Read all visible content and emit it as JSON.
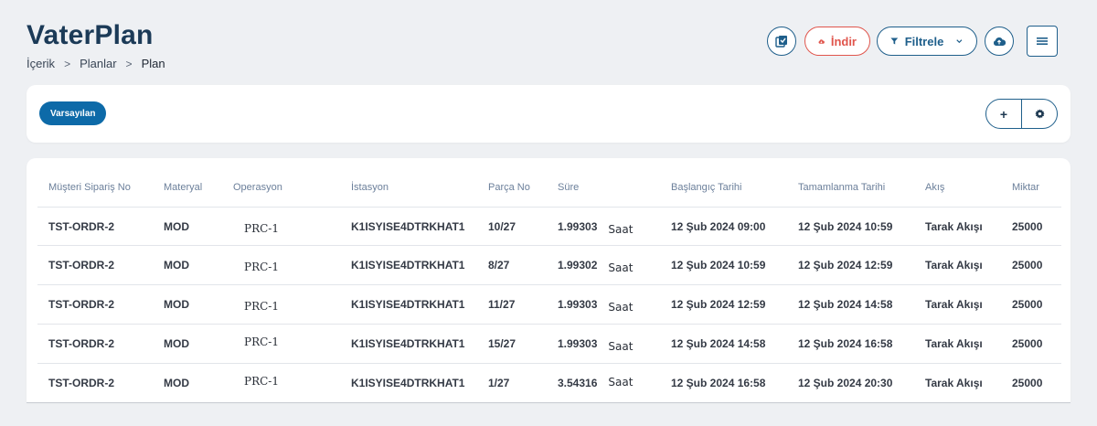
{
  "header": {
    "title": "VaterPlan",
    "breadcrumb": [
      "İçerik",
      "Planlar",
      "Plan"
    ],
    "breadcrumb_separator": ">"
  },
  "toolbar": {
    "download_label": "İndir",
    "filter_label": "Filtrele",
    "colors": {
      "primary": "#1f5f8b",
      "danger": "#e0554c"
    }
  },
  "view": {
    "chip_label": "Varsayılan",
    "add_label": "+"
  },
  "table": {
    "headers": [
      "Müşteri Sipariş No",
      "Materyal",
      "Operasyon",
      "İstasyon",
      "Parça No",
      "Süre",
      "Başlangıç Tarihi",
      "Tamamlanma Tarihi",
      "Akış",
      "Miktar"
    ],
    "rows": [
      {
        "order": "TST-ORDR-2",
        "material": "MOD",
        "operation": "PRC-1",
        "station": "K1ISYISE4DTRKHAT1",
        "part": "10/27",
        "duration": "1.99303",
        "unit": "Saat",
        "start": "12 Şub 2024 09:00",
        "end": "12 Şub 2024 10:59",
        "flow": "Tarak Akışı",
        "qty": "25000"
      },
      {
        "order": "TST-ORDR-2",
        "material": "MOD",
        "operation": "PRC-1",
        "station": "K1ISYISE4DTRKHAT1",
        "part": "8/27",
        "duration": "1.99302",
        "unit": "Saat",
        "start": "12 Şub 2024 10:59",
        "end": "12 Şub 2024 12:59",
        "flow": "Tarak Akışı",
        "qty": "25000"
      },
      {
        "order": "TST-ORDR-2",
        "material": "MOD",
        "operation": "PRC-1",
        "station": "K1ISYISE4DTRKHAT1",
        "part": "11/27",
        "duration": "1.99303",
        "unit": "Saat",
        "start": "12 Şub 2024 12:59",
        "end": "12 Şub 2024 14:58",
        "flow": "Tarak Akışı",
        "qty": "25000"
      },
      {
        "order": "TST-ORDR-2",
        "material": "MOD",
        "operation": "PRC-1",
        "station": "K1ISYISE4DTRKHAT1",
        "part": "15/27",
        "duration": "1.99303",
        "unit": "Saat",
        "start": "12 Şub 2024 14:58",
        "end": "12 Şub 2024 16:58",
        "flow": "Tarak Akışı",
        "qty": "25000"
      },
      {
        "order": "TST-ORDR-2",
        "material": "MOD",
        "operation": "PRC-1",
        "station": "K1ISYISE4DTRKHAT1",
        "part": "1/27",
        "duration": "3.54316",
        "unit": "Saat",
        "start": "12 Şub 2024 16:58",
        "end": "12 Şub 2024 20:30",
        "flow": "Tarak Akışı",
        "qty": "25000"
      }
    ]
  }
}
